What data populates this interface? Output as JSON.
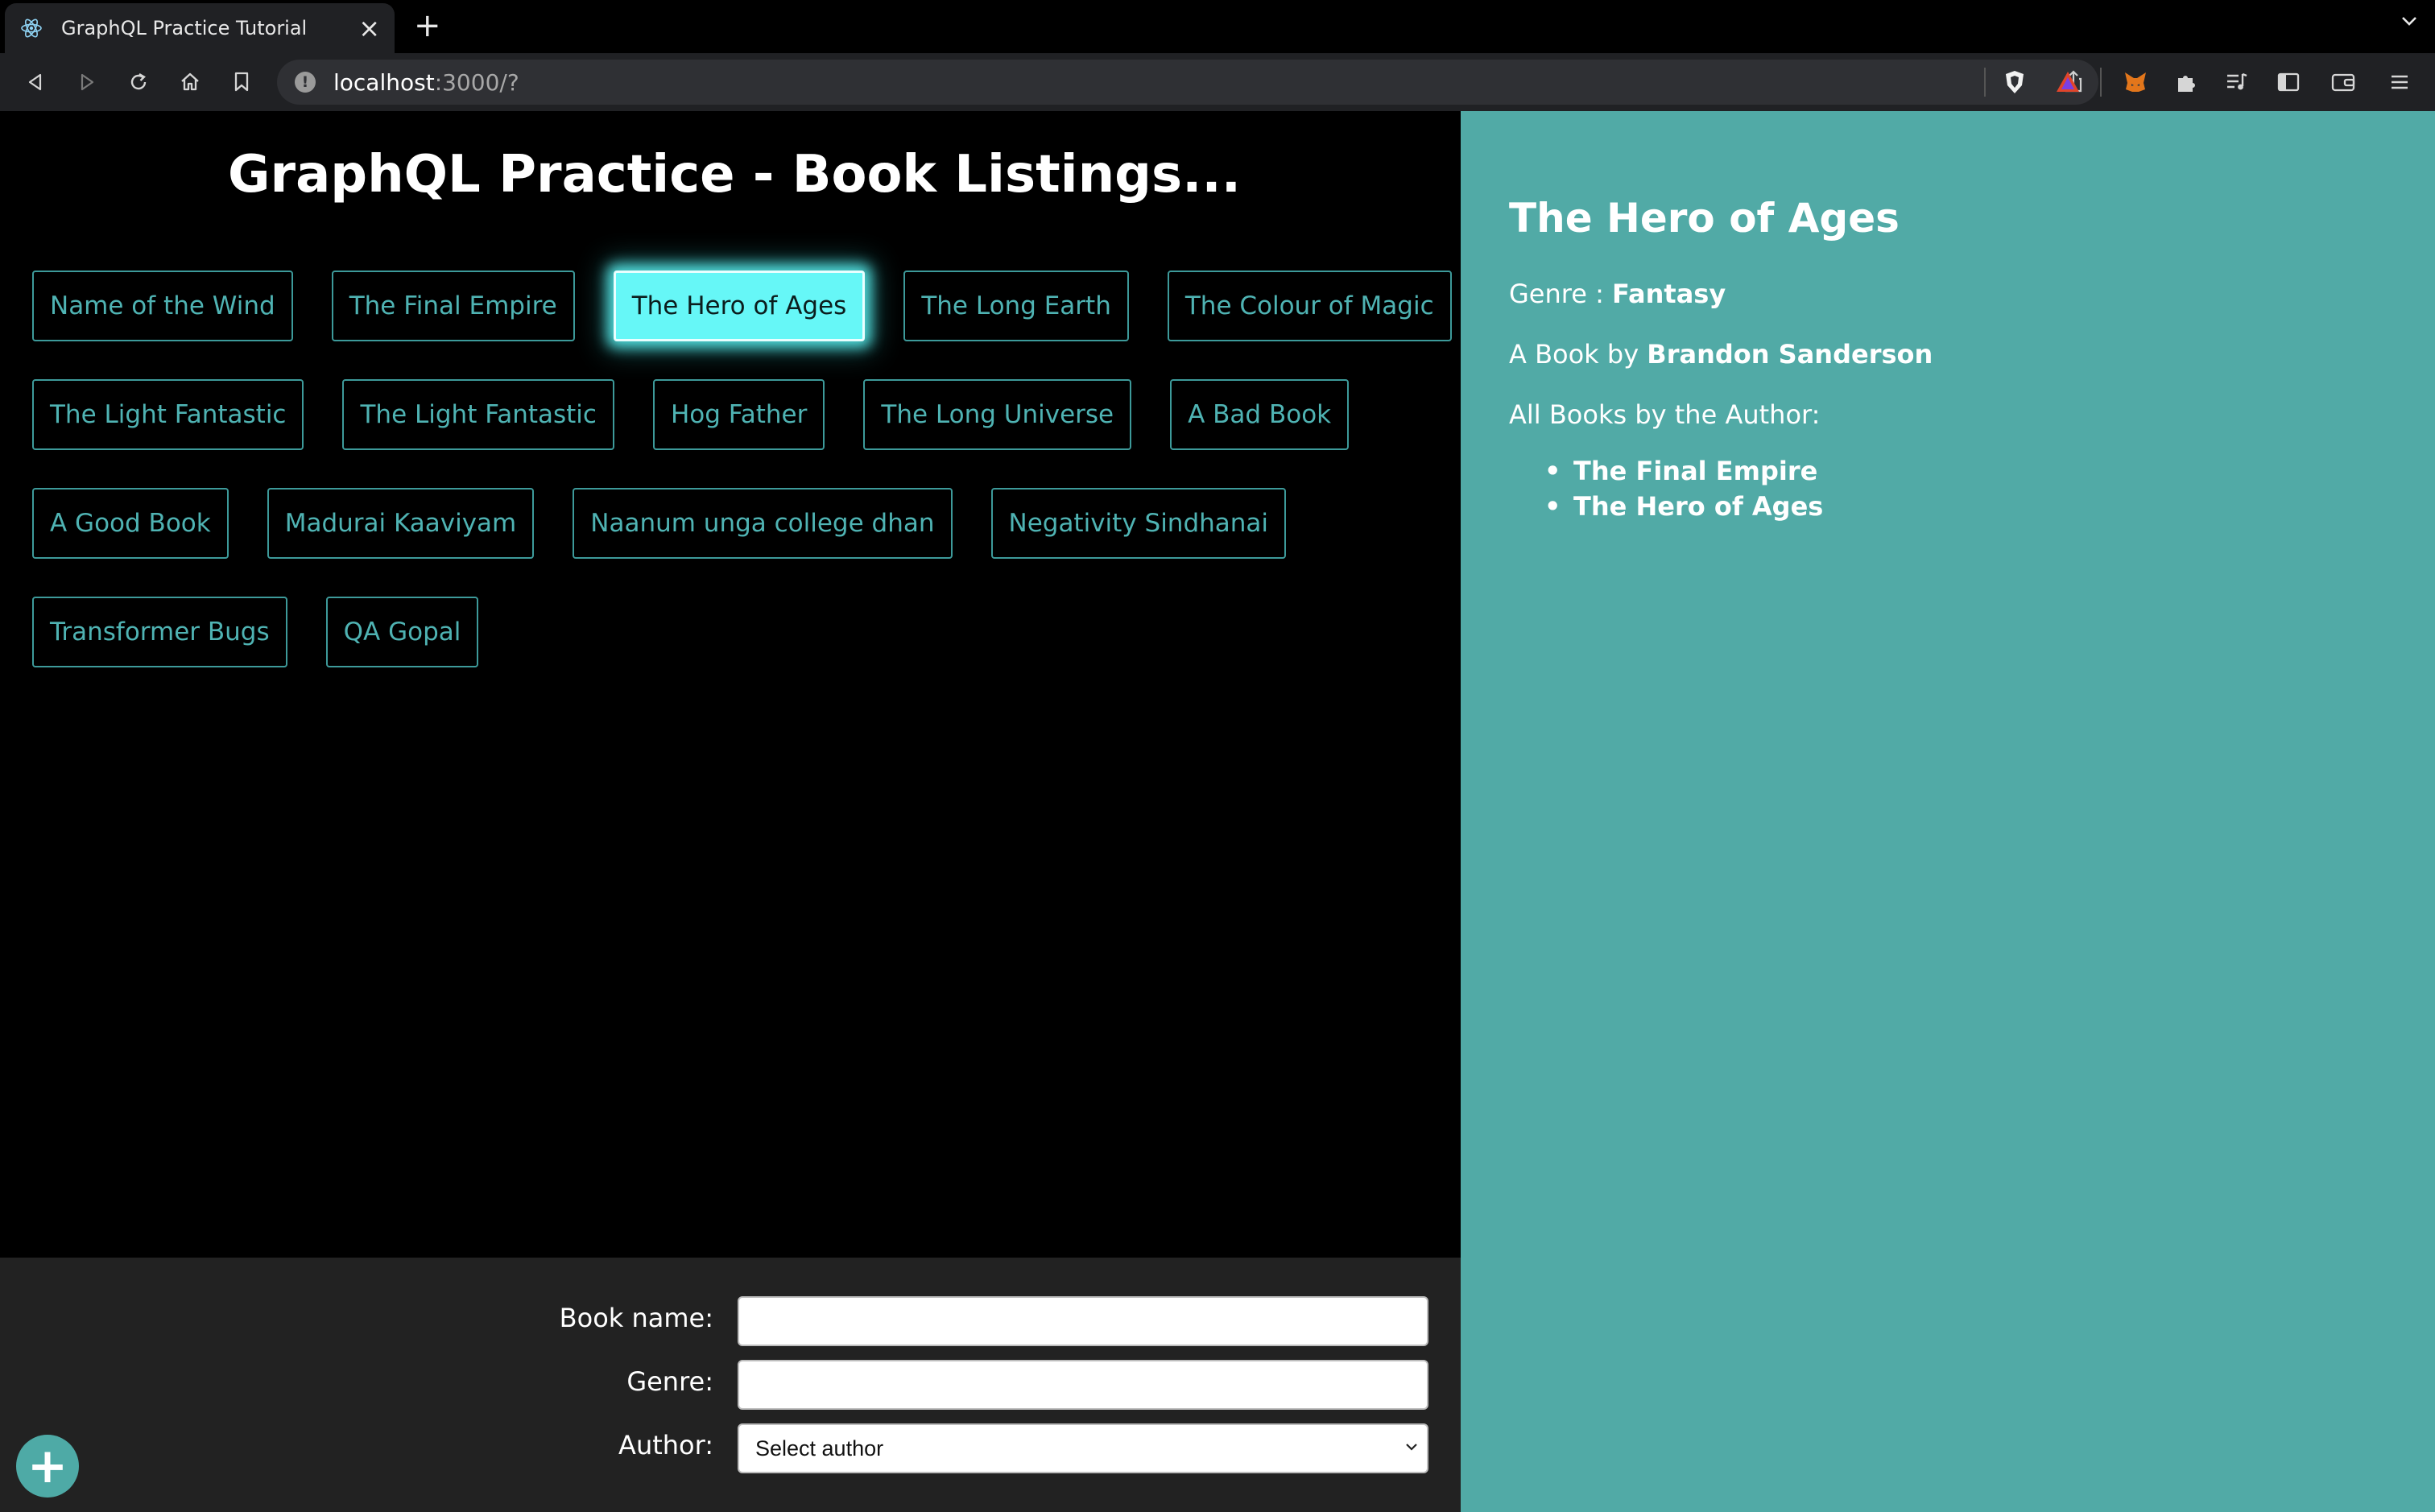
{
  "browser": {
    "tab_title": "GraphQL Practice Tutorial",
    "url_host": "localhost",
    "url_rest": ":3000/?"
  },
  "page": {
    "title": "GraphQL Practice - Book Listings...",
    "books": [
      [
        "Name of the Wind",
        "The Final Empire",
        "The Hero of Ages",
        "The Long Earth",
        "The Colour of Magic"
      ],
      [
        "The Light Fantastic",
        "The Light Fantastic",
        "Hog Father",
        "The Long Universe",
        "A Bad Book"
      ],
      [
        "A Good Book",
        "Madurai Kaaviyam",
        "Naanum unga college dhan",
        "Negativity Sindhanai"
      ],
      [
        "Transformer Bugs",
        "QA Gopal"
      ]
    ],
    "selected_book": "The Hero of Ages"
  },
  "form": {
    "book_name_label": "Book name:",
    "book_name_value": "",
    "genre_label": "Genre:",
    "genre_value": "",
    "author_label": "Author:",
    "author_selected": "Select author",
    "add_button_label": "+"
  },
  "details": {
    "title": "The Hero of Ages",
    "genre_prefix": "Genre : ",
    "genre": "Fantasy",
    "author_prefix": "A Book by ",
    "author": "Brandon Sanderson",
    "all_books_label": "All Books by the Author:",
    "author_books": [
      "The Final Empire",
      "The Hero of Ages"
    ]
  },
  "colors": {
    "accent_teal": "#51aaa6",
    "button_border": "#3d9a9a",
    "active_button_bg": "#66f7f7",
    "form_bg": "#222222"
  }
}
